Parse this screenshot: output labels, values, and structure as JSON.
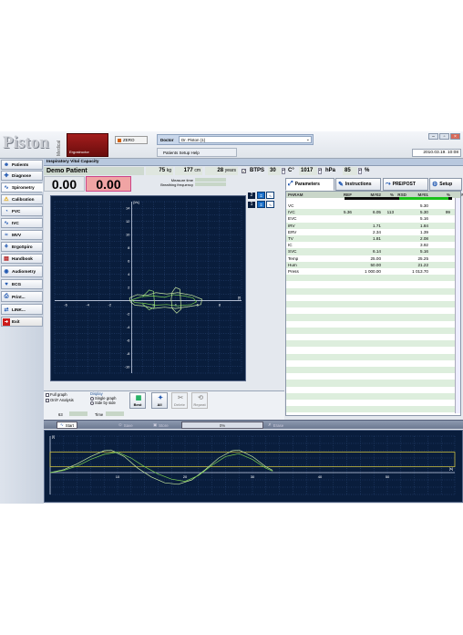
{
  "header": {
    "logo_text": "Piston",
    "medical_label": "Medical",
    "brand_label": "Ergostructor",
    "zero_button": "ZERO",
    "doctor_label": "Doctor",
    "doctor_value": "Dr. Piston (1)",
    "menu_tabs": "Patients  Setup  Help",
    "datetime": "2010.03.19. 10:08",
    "colors": {
      "brand_red": "#8f1616",
      "sidebar_blue": "#1e56b0"
    }
  },
  "sidebar": {
    "items": [
      {
        "label": "Patients",
        "icon": "patients-icon"
      },
      {
        "label": "Diagnose",
        "icon": "diagnose-icon"
      },
      {
        "label": "Spirometry",
        "icon": "spirometry-icon"
      },
      {
        "label": "Calibration",
        "icon": "warning-icon"
      },
      {
        "label": "FVC",
        "icon": "fvc-icon"
      },
      {
        "label": "IVC",
        "icon": "ivc-icon"
      },
      {
        "label": "MVV",
        "icon": "mvv-icon"
      },
      {
        "label": "ErgoSpiro",
        "icon": "ergospiro-icon"
      },
      {
        "label": "Handbook",
        "icon": "handbook-icon"
      },
      {
        "label": "Audiometry",
        "icon": "audiometry-icon"
      },
      {
        "label": "ECG",
        "icon": "ecg-icon"
      },
      {
        "label": "Print...",
        "icon": "print-icon"
      },
      {
        "label": "LINK...",
        "icon": "link-icon"
      },
      {
        "label": "Exit",
        "icon": "exit-icon"
      }
    ]
  },
  "test": {
    "title": "Inspiratory Vital Capacity",
    "patient": "Demo Patient",
    "weight": "75",
    "weight_unit": "kg",
    "height": "177",
    "height_unit": "cm",
    "age": "28",
    "age_unit": "years",
    "btps_label": "BTPS",
    "btps_value": "30",
    "temp_unit": "C°",
    "pressure": "1017",
    "pressure_unit": "hPa",
    "humidity": "85",
    "humidity_unit": "%",
    "value1": "0.00",
    "value2": "0.00",
    "measure_time_label": "Measure time",
    "breathing_freq_label": "Breathing frequency"
  },
  "flow_volume": {
    "y_unit": "l/s",
    "x_unit": "l",
    "y_ticks": [
      "14",
      "12",
      "10",
      "8",
      "6",
      "4",
      "2",
      "-2",
      "-4",
      "-6",
      "-8",
      "-10"
    ],
    "x_ticks": [
      "-6",
      "-4",
      "-2",
      "2",
      "4",
      "6",
      "8"
    ],
    "curve_count_labels": [
      "2",
      "1"
    ]
  },
  "controls": {
    "full_graph": "Full graph",
    "only_analysis": "OnlY Analysis",
    "display_label": "Display",
    "single_graph": "Single graph",
    "side_by_side": "Side by side",
    "best": "Best",
    "all": "All",
    "delete": "Delete",
    "repeat": "Repeat",
    "counter": "63",
    "time_label": "Time"
  },
  "panel_tabs": [
    "Parameters",
    "Instructions",
    "PRE/POST",
    "Setup"
  ],
  "table": {
    "headers": [
      "PARAM",
      "REF",
      "M#02",
      "%",
      "RSD",
      "M#01",
      "%",
      "RSD"
    ],
    "rows": [
      [
        "VC",
        "",
        "",
        "",
        "",
        "5.30",
        "",
        ""
      ],
      [
        "IVC",
        "5.36",
        "6.05",
        "113",
        "",
        "5.30",
        "99",
        ""
      ],
      [
        "EVC",
        "",
        "",
        "",
        "",
        "5.16",
        "",
        ""
      ],
      [
        "IRV",
        "",
        "1.71",
        "",
        "",
        "1.84",
        "",
        ""
      ],
      [
        "ERV",
        "",
        "2.34",
        "",
        "",
        "1.39",
        "",
        ""
      ],
      [
        "TV",
        "",
        "1.81",
        "",
        "",
        "2.08",
        "",
        ""
      ],
      [
        "IC",
        "",
        "",
        "",
        "",
        "3.92",
        "",
        ""
      ],
      [
        "SVC",
        "",
        "6.14",
        "",
        "",
        "5.16",
        "",
        ""
      ],
      [
        "Temp",
        "",
        "25.00",
        "",
        "",
        "25.25",
        "",
        ""
      ],
      [
        "Hum",
        "",
        "50.00",
        "",
        "",
        "21.22",
        "",
        ""
      ],
      [
        "Press",
        "",
        "1 000.00",
        "",
        "",
        "1 013.70",
        "",
        ""
      ]
    ]
  },
  "bottom_toolbar": {
    "start": "Start",
    "save": "Save",
    "store": "Store",
    "percent": "0%",
    "erase": "Erase"
  },
  "volume_time": {
    "y_unit": "l",
    "x_unit": "s",
    "x_ticks": [
      "10",
      "20",
      "30",
      "40",
      "50"
    ]
  }
}
